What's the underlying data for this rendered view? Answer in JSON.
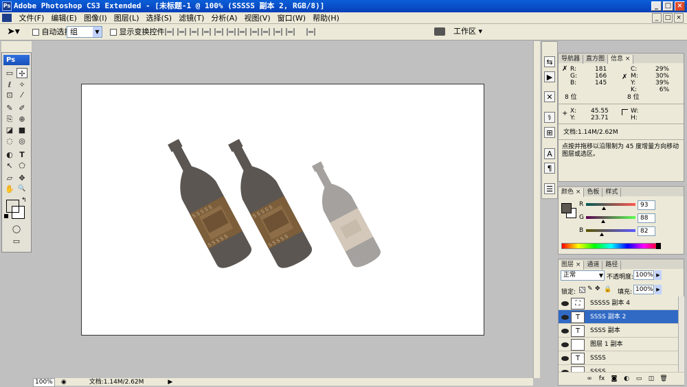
{
  "app": {
    "title": "Adobe Photoshop CS3 Extended - [未标题-1 @ 100% (SSSSS 副本 2, RGB/8)]",
    "icon_label": "Ps"
  },
  "window_controls": {
    "minimize": "_",
    "maximize": "□",
    "close": "×"
  },
  "mdi_controls": {
    "minimize": "_",
    "restore": "□",
    "close": "×"
  },
  "menu": [
    "文件(F)",
    "编辑(E)",
    "图像(I)",
    "图层(L)",
    "选择(S)",
    "滤镜(T)",
    "分析(A)",
    "视图(V)",
    "窗口(W)",
    "帮助(H)"
  ],
  "options": {
    "auto_select_label": "自动选择:",
    "auto_select_value": "组",
    "show_transform_label": "显示变换控件",
    "workspace_label": "工作区 ▾"
  },
  "toolbox": {
    "logo": "Ps",
    "tools": [
      "▭",
      "✢",
      "ℓ",
      "✧",
      "⊡",
      "⁄",
      "✎",
      "✐",
      "⎘",
      "⊕",
      "◪",
      "■",
      "◌",
      "◎",
      "◐",
      "T",
      "↖",
      "⬠",
      "▱",
      "✥",
      "✋",
      "🔍"
    ],
    "fg_color": "#5d5753",
    "mode_icons": [
      "◯",
      "▭"
    ]
  },
  "status": {
    "zoom": "100%",
    "doc_info": "文档:1.14M/2.62M"
  },
  "dock_icons": [
    "⇆",
    "▶",
    "✕",
    "⚕",
    "⊞",
    "A",
    "¶",
    "☰"
  ],
  "info_panel": {
    "tabs": [
      "导航器",
      "直方图",
      "信息 ×"
    ],
    "rgb": [
      {
        "k": "R:",
        "v": "181"
      },
      {
        "k": "G:",
        "v": "166"
      },
      {
        "k": "B:",
        "v": "145"
      }
    ],
    "cmyk": [
      {
        "k": "C:",
        "v": "29%"
      },
      {
        "k": "M:",
        "v": "30%"
      },
      {
        "k": "Y:",
        "v": "39%"
      },
      {
        "k": "K:",
        "v": "6%"
      }
    ],
    "bit_left": "8 位",
    "bit_right": "8 位",
    "xy": [
      {
        "k": "X:",
        "v": "45.55"
      },
      {
        "k": "Y:",
        "v": "23.71"
      }
    ],
    "wh": [
      {
        "k": "W:",
        "v": ""
      },
      {
        "k": "H:",
        "v": ""
      }
    ],
    "doc": "文档:1.14M/2.62M",
    "hint": "点按并拖移以沿限制为 45 度增量方向移动图层或选区。"
  },
  "color_panel": {
    "tabs": [
      "颜色 ×",
      "色板",
      "样式"
    ],
    "channels": [
      {
        "label": "R",
        "value": "93",
        "level": 0.365
      },
      {
        "label": "G",
        "value": "88",
        "level": 0.345
      },
      {
        "label": "B",
        "value": "82",
        "level": 0.322
      }
    ],
    "swatch": "#5d5852"
  },
  "layers_panel": {
    "tabs": [
      "图层 ×",
      "通道",
      "路径"
    ],
    "blend_mode": "正常",
    "opacity_label": "不透明度:",
    "opacity_value": "100%",
    "lock_label": "锁定:",
    "fill_label": "填充:",
    "fill_value": "100%",
    "layers": [
      {
        "name": "SSSSS 副本 4",
        "thumb": "⛶",
        "selected": false
      },
      {
        "name": "SSSS 副本 2",
        "thumb": "T",
        "selected": true
      },
      {
        "name": "SSSS 副本",
        "thumb": "T",
        "selected": false
      },
      {
        "name": "图层 1 副本",
        "thumb": "",
        "selected": false
      },
      {
        "name": "SSSS",
        "thumb": "T",
        "selected": false
      },
      {
        "name": "SSSS",
        "thumb": "",
        "selected": false
      }
    ],
    "footer_icons": [
      "∞",
      "fx",
      "◙",
      "◐",
      "▭",
      "◫",
      "🗑"
    ]
  },
  "colors": {
    "bottle_dark": "#5b5652",
    "bottle_light": "#9a9694",
    "label_brown": "#7c5e3a",
    "label_light": "#b3a38c",
    "accent_blue": "#316ac5"
  }
}
